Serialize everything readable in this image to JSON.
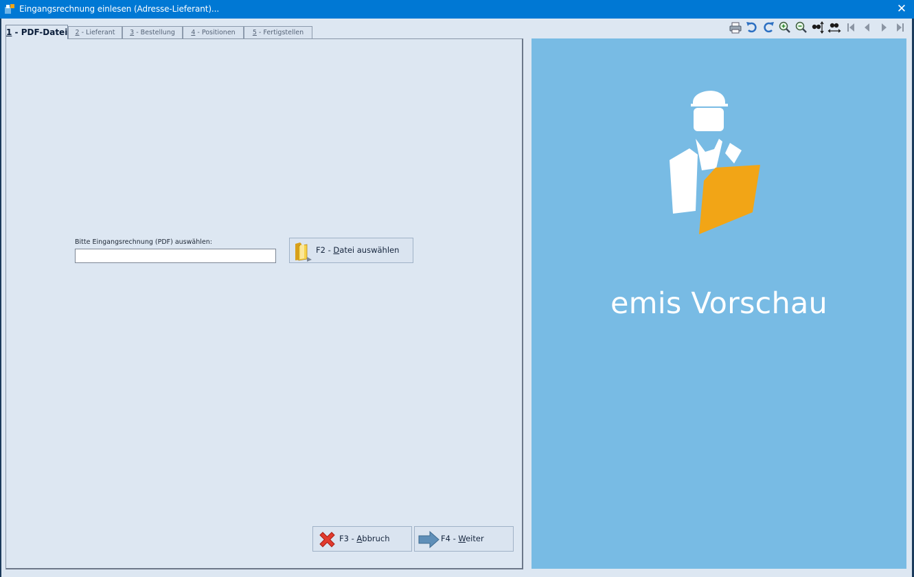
{
  "window": {
    "title": "Eingangsrechnung einlesen (Adresse-Lieferant)...",
    "close_glyph": "✕"
  },
  "tabs": [
    {
      "key": "1",
      "label": " - PDF-Datei",
      "active": true
    },
    {
      "key": "2",
      "label": " - Lieferant",
      "active": false
    },
    {
      "key": "3",
      "label": " - Bestellung",
      "active": false
    },
    {
      "key": "4",
      "label": " - Positionen",
      "active": false
    },
    {
      "key": "5",
      "label": " - Fertigstellen",
      "active": false
    }
  ],
  "form": {
    "file_label": "Bitte Eingangsrechnung (PDF) auswählen:",
    "file_value": "",
    "select_button": {
      "prefix": "F2 - ",
      "key": "D",
      "rest": "atei auswählen",
      "icon": "folder-icon"
    }
  },
  "footer": {
    "cancel_button": {
      "prefix": "F3 - ",
      "key": "A",
      "rest": "bbruch",
      "icon": "red-x-icon"
    },
    "next_button": {
      "prefix": "F4 - ",
      "key": "W",
      "rest": "eiter",
      "icon": "arrow-right-icon"
    }
  },
  "toolbar": [
    "print-icon",
    "undo-icon",
    "redo-icon",
    "zoom-in-icon",
    "zoom-out-icon",
    "fit-height-icon",
    "fit-width-icon",
    "first-page-icon",
    "previous-page-icon",
    "next-page-icon",
    "last-page-icon"
  ],
  "preview": {
    "title": "emis Vorschau",
    "logo": "worker-with-document-logo"
  },
  "colors": {
    "titlebar": "#0078d4",
    "window_bg": "#dde7f2",
    "preview_bg": "#78bbe4",
    "accent_orange": "#f2a516"
  }
}
